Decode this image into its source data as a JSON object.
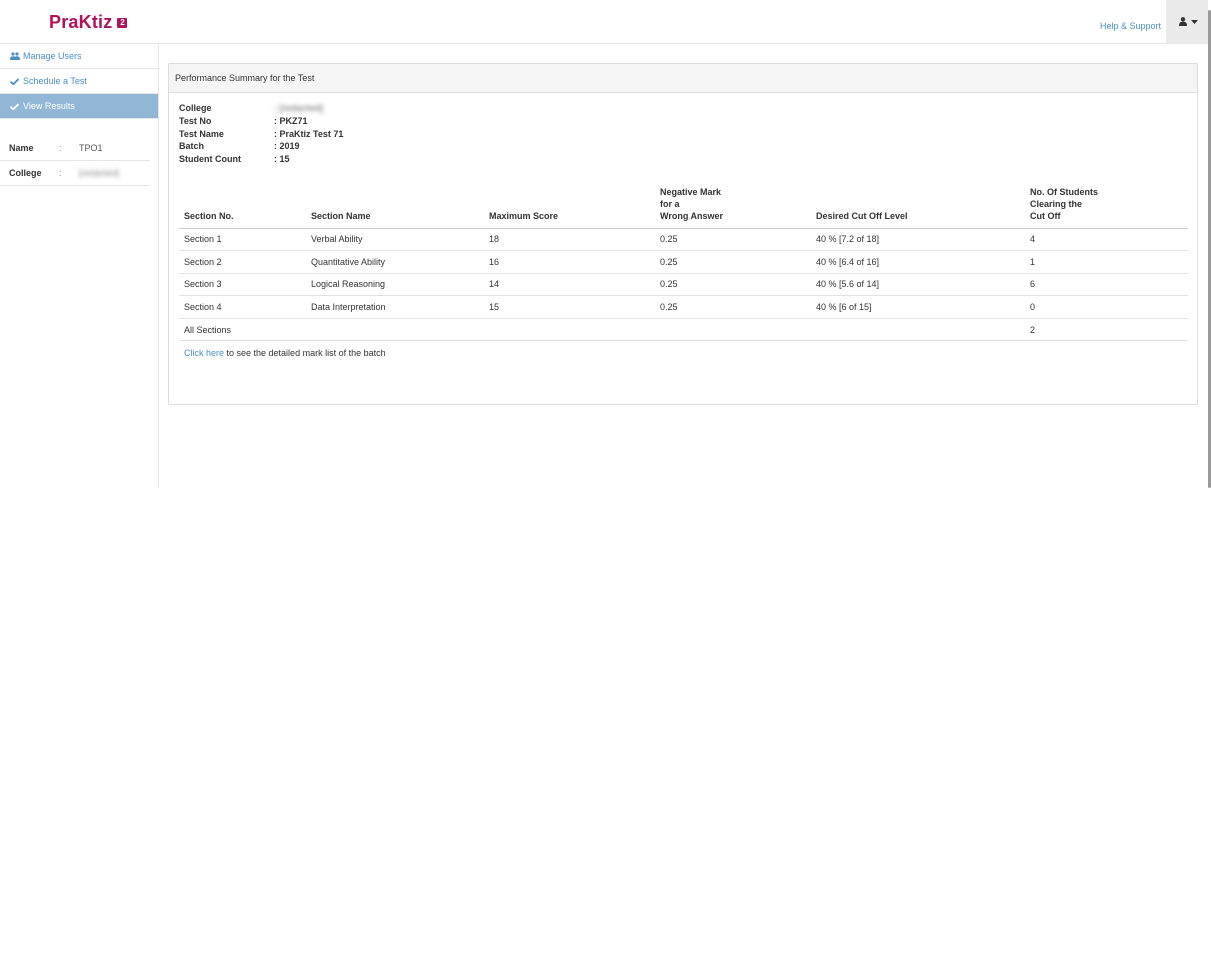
{
  "brand": {
    "name": "PraKtiz",
    "badge": "2"
  },
  "header": {
    "help_label": "Help & Support",
    "user_icon": "user-icon"
  },
  "sidebar": {
    "items": [
      {
        "label": "Manage Users",
        "icon": "users-icon"
      },
      {
        "label": "Schedule a Test",
        "icon": "check-icon"
      },
      {
        "label": "View Results",
        "icon": "check-icon",
        "active": true
      }
    ],
    "info": [
      {
        "label": "Name",
        "colon": ":",
        "value": "TPO1"
      },
      {
        "label": "College",
        "colon": ":",
        "value": "[redacted]"
      }
    ]
  },
  "panel": {
    "heading": "Performance Summary for the Test",
    "meta": [
      {
        "label": "College",
        "value": ": [redacted]"
      },
      {
        "label": "Test No",
        "value": ": PKZ71"
      },
      {
        "label": "Test Name",
        "value": ": PraKtiz Test 71"
      },
      {
        "label": "Batch",
        "value": ": 2019"
      },
      {
        "label": "Student Count",
        "value": ": 15"
      }
    ],
    "table": {
      "headers": [
        [
          "Section No."
        ],
        [
          "Section Name"
        ],
        [
          "Maximum Score"
        ],
        [
          "Negative Mark",
          "for a",
          "Wrong Answer"
        ],
        [
          "Desired Cut Off Level"
        ],
        [
          "No. Of Students",
          "Clearing the",
          "Cut Off"
        ]
      ],
      "rows": [
        [
          "Section 1",
          "Verbal Ability",
          "18",
          "0.25",
          "40 % [7.2 of 18]",
          "4"
        ],
        [
          "Section 2",
          "Quantitative Ability",
          "16",
          "0.25",
          "40 % [6.4 of 16]",
          "1"
        ],
        [
          "Section 3",
          "Logical Reasoning",
          "14",
          "0.25",
          "40 % [5.6 of 14]",
          "6"
        ],
        [
          "Section 4",
          "Data Interpretation",
          "15",
          "0.25",
          "40 % [6 of 15]",
          "0"
        ],
        [
          "All Sections",
          "",
          "",
          "",
          "",
          "2"
        ]
      ]
    },
    "footer": {
      "link_label": "Click here",
      "text": " to see the detailed mark list of the batch"
    }
  },
  "colors": {
    "brand": "#b0125b",
    "link": "#4a90c6",
    "active_nav": "#92b7d6"
  }
}
